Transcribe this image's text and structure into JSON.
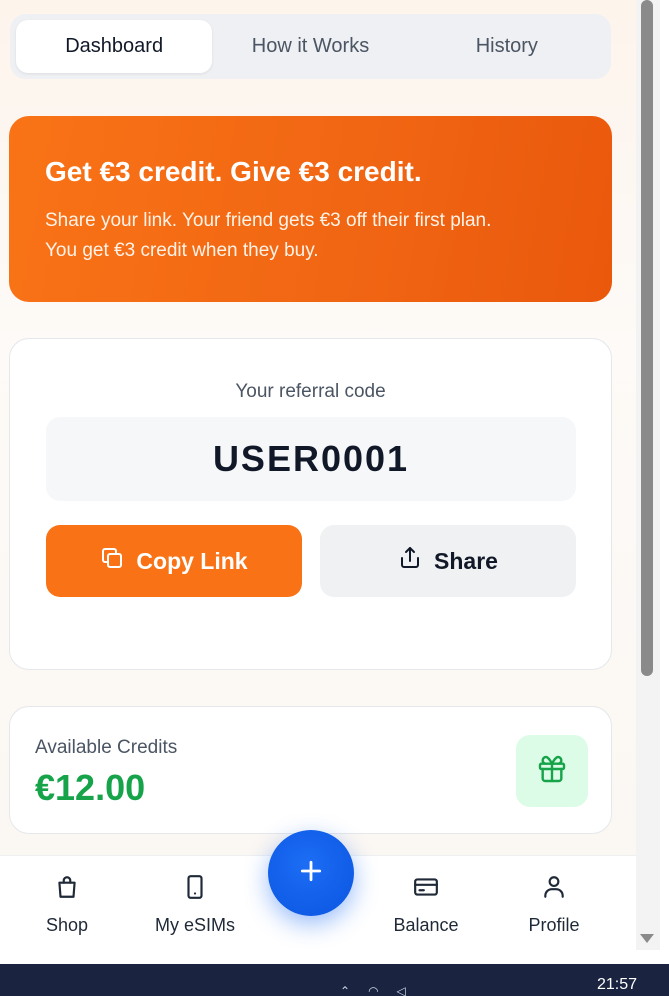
{
  "tabs": [
    {
      "label": "Dashboard",
      "active": true
    },
    {
      "label": "How it Works",
      "active": false
    },
    {
      "label": "History",
      "active": false
    }
  ],
  "promo": {
    "title": "Get €3 credit. Give €3 credit.",
    "line1": "Share your link. Your friend gets €3 off their first plan.",
    "line2": "You get €3 credit when they buy."
  },
  "referral": {
    "label": "Your referral code",
    "code": "USER0001",
    "copy_label": "Copy Link",
    "share_label": "Share"
  },
  "credits": {
    "label": "Available Credits",
    "value": "€12.00"
  },
  "nav": {
    "shop": "Shop",
    "esims": "My eSIMs",
    "balance": "Balance",
    "profile": "Profile"
  },
  "taskbar": {
    "time": "21:57"
  },
  "colors": {
    "accent": "#f97316",
    "credits_green": "#16a34a",
    "fab_blue": "#1d6df5"
  },
  "icons": [
    "copy-icon",
    "share-icon",
    "gift-icon",
    "shopping-bag-icon",
    "phone-icon",
    "plus-icon",
    "credit-card-icon",
    "user-icon"
  ]
}
